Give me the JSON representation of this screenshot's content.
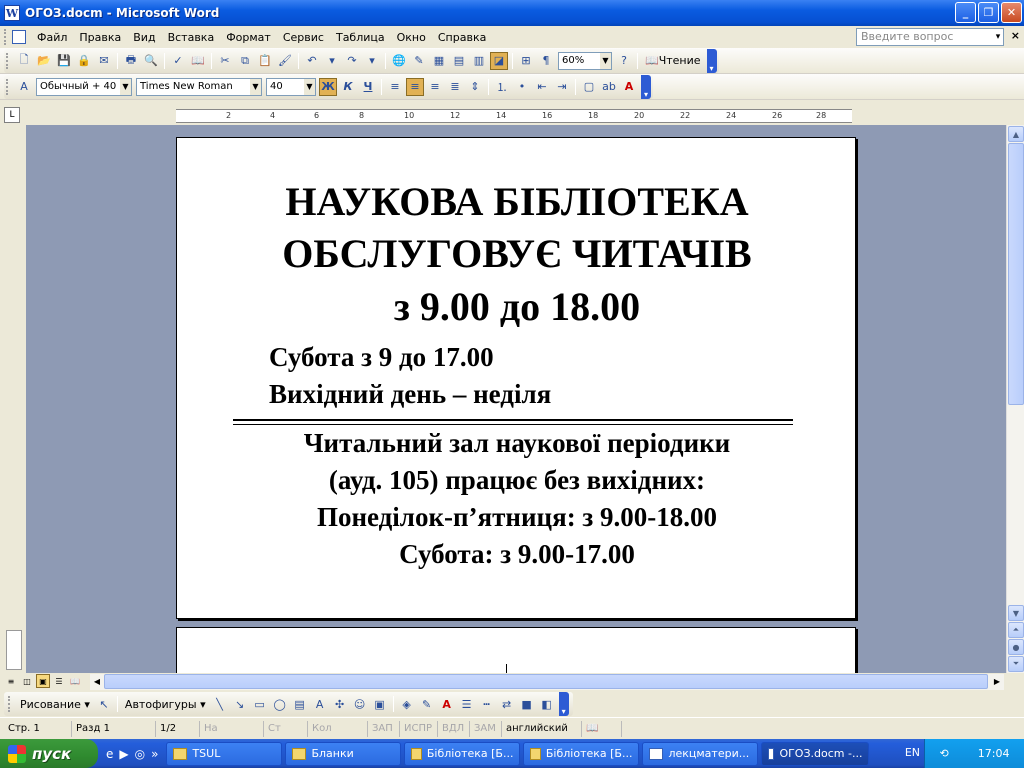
{
  "window": {
    "title": "ОГОЗ.docm - Microsoft Word",
    "min_label": "_",
    "max_label": "❐",
    "close_label": "✕"
  },
  "menu": {
    "items": [
      "Файл",
      "Правка",
      "Вид",
      "Вставка",
      "Формат",
      "Сервис",
      "Таблица",
      "Окно",
      "Справка"
    ],
    "ask_placeholder": "Введите вопрос",
    "close_glyph": "×"
  },
  "toolbar_standard": {
    "zoom": "60%",
    "read_label": "Чтение"
  },
  "toolbar_formatting": {
    "style": "Обычный + 40 г",
    "font": "Times New Roman",
    "size": "40",
    "bold": "Ж",
    "italic": "К",
    "underline": "Ч"
  },
  "ruler": {
    "ticks": [
      "2",
      "4",
      "6",
      "8",
      "10",
      "12",
      "14",
      "16",
      "18",
      "20",
      "22",
      "24",
      "26",
      "28"
    ]
  },
  "document": {
    "line1": "НАУКОВА БІБЛІОТЕКА",
    "line2": "ОБСЛУГОВУЄ ЧИТАЧІВ",
    "line3": "з 9.00 до 18.00",
    "line4": "Субота з 9 до 17.00",
    "line5": "Вихідний день – неділя",
    "line6": "Читальний зал наукової періодики",
    "line7": "(ауд. 105) працює без вихідних:",
    "line8": "Понеділок-п’ятниця: з 9.00-18.00",
    "line9": "Субота: з 9.00-17.00"
  },
  "drawing_toolbar": {
    "draw_label": "Рисование ▾",
    "autoshapes_label": "Автофигуры ▾"
  },
  "status": {
    "page": "Стр. 1",
    "section": "Разд 1",
    "pages": "1/2",
    "at": "На",
    "ln": "Ст",
    "col": "Кол",
    "rec": "ЗАП",
    "trk": "ИСПР",
    "ext": "ВДЛ",
    "ovr": "ЗАМ",
    "lang": "английский"
  },
  "taskbar": {
    "start_label": "пуск",
    "tasks": [
      {
        "label": "TSUL",
        "active": false
      },
      {
        "label": "Бланки",
        "active": false
      },
      {
        "label": "Бібліотека [Б...",
        "active": false
      },
      {
        "label": "Бібліотека [Б...",
        "active": false
      },
      {
        "label": "лекцматери...",
        "active": false
      },
      {
        "label": "ОГОЗ.docm -...",
        "active": true
      }
    ],
    "lang": "EN",
    "clock": "17:04"
  }
}
